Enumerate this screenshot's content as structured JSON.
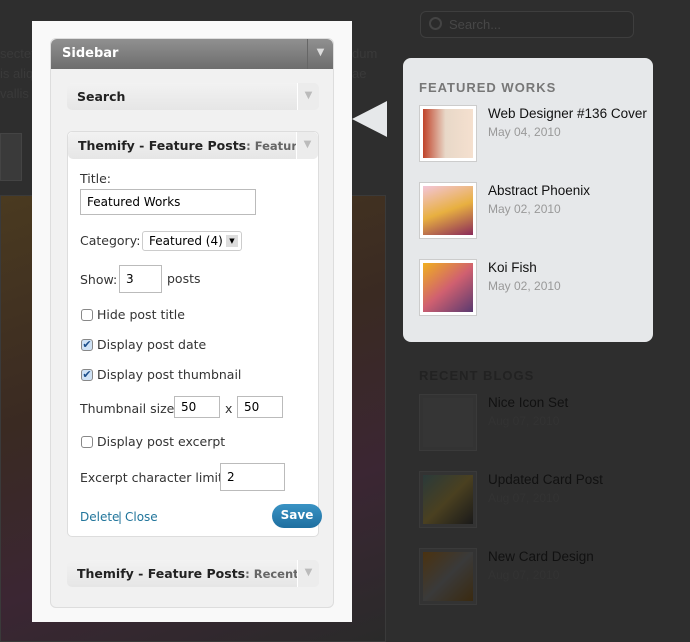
{
  "background": {
    "text_lines": [
      "sectet",
      "is aliq",
      "vallis v"
    ],
    "text_right": [
      "dum",
      "ae"
    ],
    "search_placeholder": "Search..."
  },
  "sidebar": {
    "title": "Sidebar",
    "widgets": [
      {
        "title": "Search"
      },
      {
        "title": "Themify - Feature Posts",
        "subtitle": ": Featured W",
        "form": {
          "title_label": "Title:",
          "title_value": "Featured Works",
          "category_label": "Category:",
          "category_value": "Featured (4)",
          "show_label": "Show:",
          "show_value": "3",
          "posts_label": "posts",
          "hide_post_title": {
            "label": "Hide post title",
            "checked": false
          },
          "display_post_date": {
            "label": "Display post date",
            "checked": true
          },
          "display_post_thumbnail": {
            "label": "Display post thumbnail",
            "checked": true
          },
          "thumb_size_label": "Thumbnail size",
          "thumb_w": "50",
          "thumb_x": "x",
          "thumb_h": "50",
          "display_post_excerpt": {
            "label": "Display post excerpt",
            "checked": false
          },
          "excerpt_limit_label": "Excerpt character limit:",
          "excerpt_limit_value": "2",
          "delete": "Delete",
          "sep": "|",
          "close": "Close",
          "save": "Save"
        }
      },
      {
        "title": "Themify - Feature Posts",
        "subtitle": ": Recent Blo"
      }
    ]
  },
  "featured": {
    "heading": "FEATURED WORKS",
    "items": [
      {
        "title": "Web Designer #136 Cover",
        "date": "May 04, 2010"
      },
      {
        "title": "Abstract Phoenix",
        "date": "May 02, 2010"
      },
      {
        "title": "Koi Fish",
        "date": "May 02, 2010"
      }
    ]
  },
  "recent": {
    "heading": "RECENT BLOGS",
    "items": [
      {
        "title": "Nice Icon Set",
        "date": "Aug 07, 2010"
      },
      {
        "title": "Updated Card Post",
        "date": "Aug 07, 2010"
      },
      {
        "title": "New Card Design",
        "date": "Aug 07, 2010"
      }
    ]
  }
}
